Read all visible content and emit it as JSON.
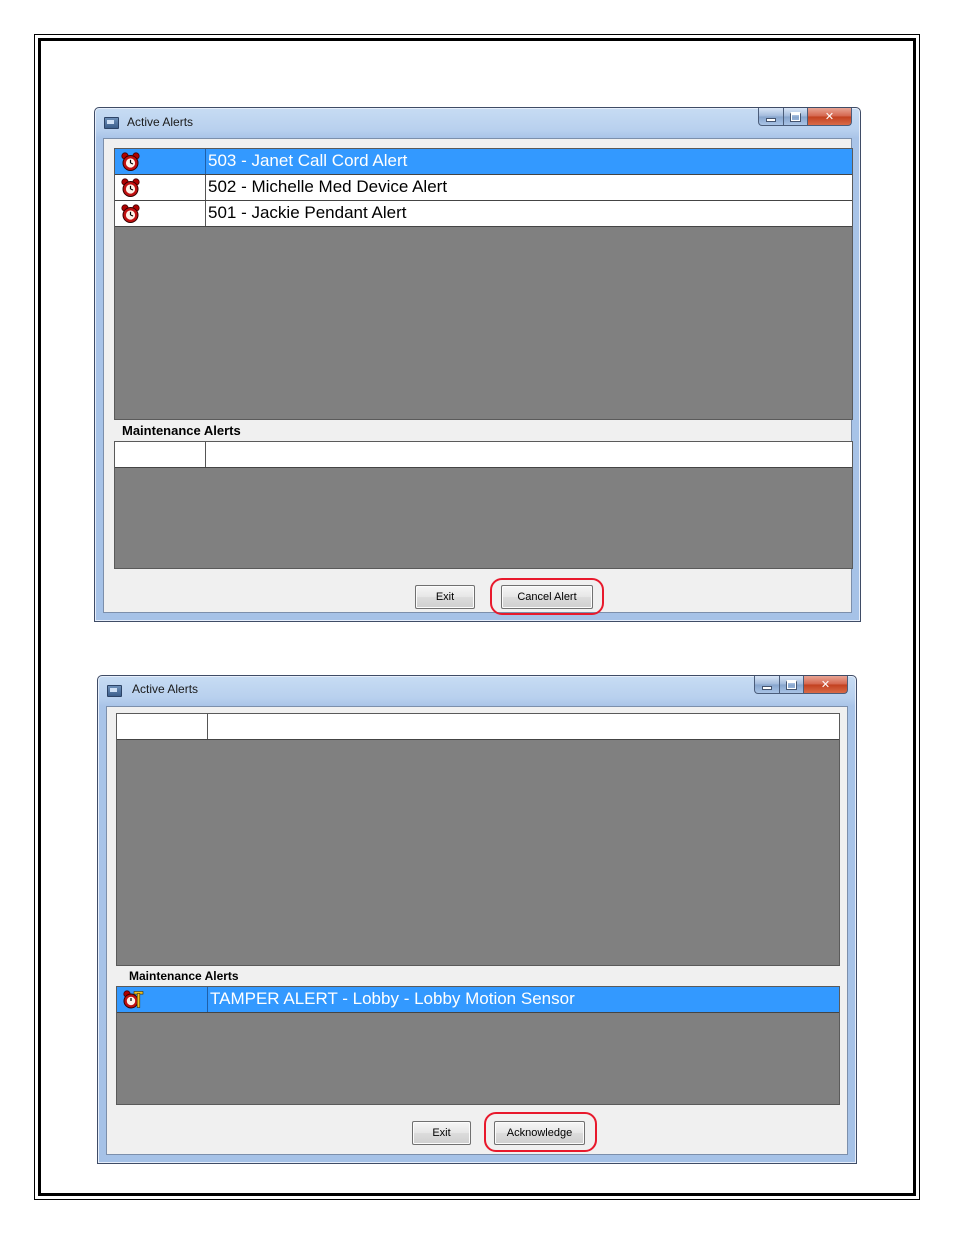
{
  "screen1": {
    "window_title": "Active Alerts",
    "alerts": [
      {
        "label": "503 - Janet Call Cord Alert",
        "icon": "alarm-clock-icon",
        "selected": true
      },
      {
        "label": "502 - Michelle Med Device Alert",
        "icon": "alarm-clock-icon",
        "selected": false
      },
      {
        "label": "501 - Jackie Pendant Alert",
        "icon": "alarm-clock-icon",
        "selected": false
      }
    ],
    "maintenance_label": "Maintenance Alerts",
    "exit_button": "Exit",
    "cancel_alert_button": "Cancel Alert"
  },
  "screen2": {
    "window_title": "Active Alerts",
    "maintenance_label": "Maintenance Alerts",
    "maintenance_alerts": [
      {
        "label": "TAMPER ALERT - Lobby - Lobby Motion Sensor",
        "icon": "tamper-alarm-icon",
        "selected": true
      }
    ],
    "exit_button": "Exit",
    "acknowledge_button": "Acknowledge"
  },
  "colors": {
    "selection": "#3399ff",
    "list_background": "#808080",
    "highlight_ring": "#e8192c"
  }
}
